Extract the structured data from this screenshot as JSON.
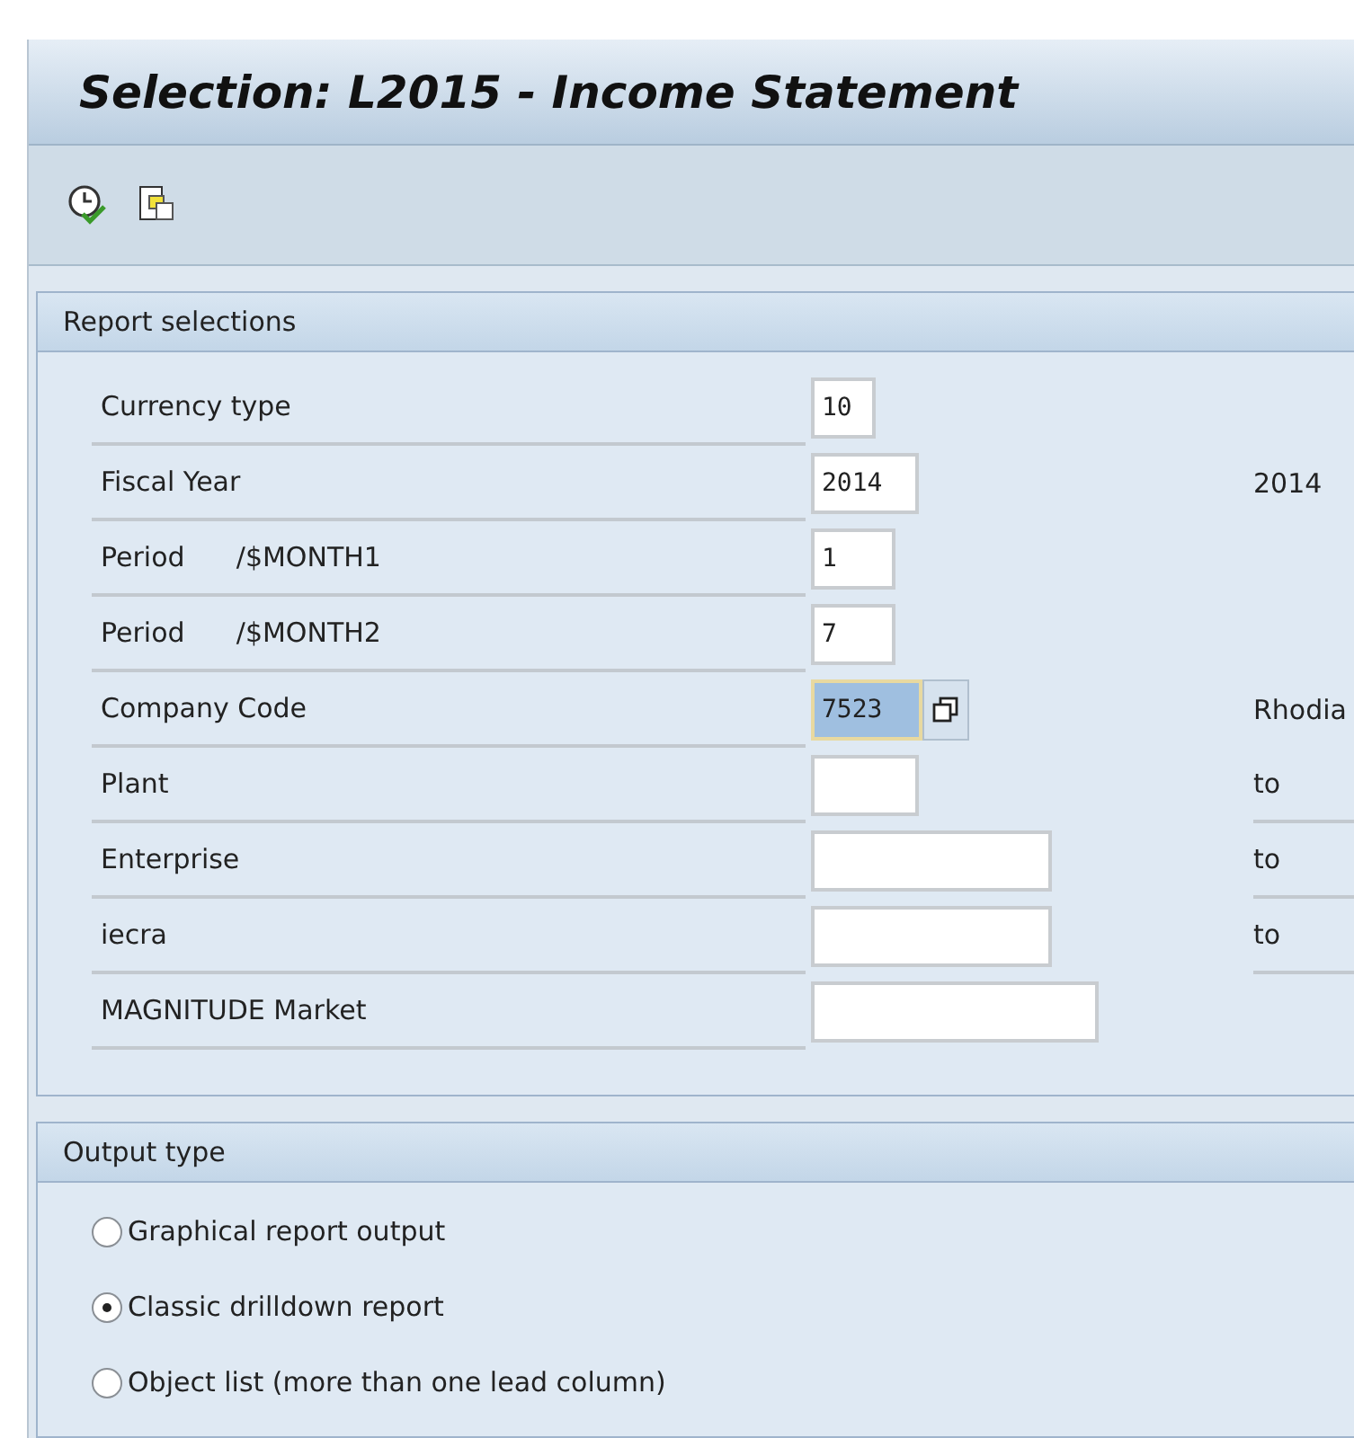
{
  "window": {
    "title": "Selection: L2015 - Income Statement"
  },
  "report_selections": {
    "title": "Report selections",
    "rows": [
      {
        "label": "Currency type",
        "kind": "single",
        "value": "10",
        "focused": false
      },
      {
        "label": "Fiscal Year",
        "kind": "single",
        "value": "2014",
        "focused": false,
        "description": "2014"
      },
      {
        "label": "Period",
        "variable": "/$MONTH1",
        "kind": "single",
        "value": "1",
        "focused": false
      },
      {
        "label": "Period",
        "variable": "/$MONTH2",
        "kind": "single",
        "value": "7",
        "focused": false
      },
      {
        "label": "Company Code",
        "kind": "multi",
        "value": "7523",
        "focused": true,
        "description": "Rhodia"
      },
      {
        "label": "Plant",
        "kind": "range",
        "value": "",
        "focused": false,
        "to_label": "to"
      },
      {
        "label": "Enterprise",
        "kind": "range",
        "value": "",
        "focused": false,
        "to_label": "to"
      },
      {
        "label": "iecra",
        "kind": "range",
        "value": "",
        "focused": false,
        "to_label": "to"
      },
      {
        "label": "MAGNITUDE Market",
        "kind": "single",
        "value": "",
        "focused": false
      }
    ]
  },
  "output_type": {
    "title": "Output type",
    "options": [
      {
        "label": "Graphical report output",
        "selected": false
      },
      {
        "label": "Classic drilldown report",
        "selected": true
      },
      {
        "label": "Object list (more than one lead column)",
        "selected": false
      }
    ]
  }
}
